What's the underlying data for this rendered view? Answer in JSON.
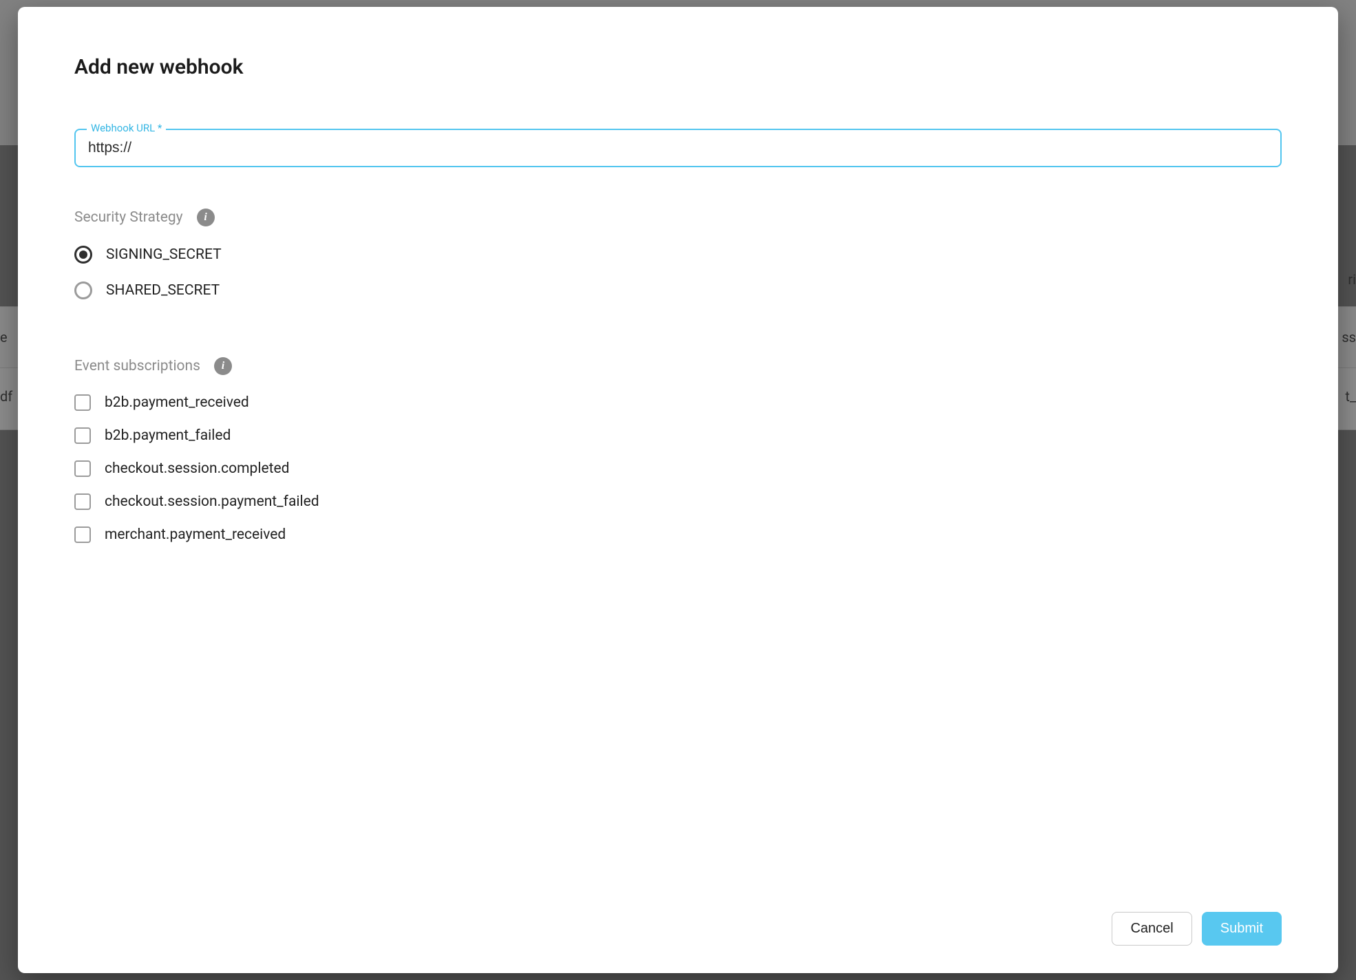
{
  "modal": {
    "title": "Add new webhook",
    "url_field": {
      "label": "Webhook URL *",
      "value": "https://"
    },
    "security": {
      "label": "Security Strategy",
      "options": [
        {
          "value": "SIGNING_SECRET",
          "selected": true
        },
        {
          "value": "SHARED_SECRET",
          "selected": false
        }
      ]
    },
    "events": {
      "label": "Event subscriptions",
      "items": [
        {
          "name": "b2b.payment_received",
          "checked": false
        },
        {
          "name": "b2b.payment_failed",
          "checked": false
        },
        {
          "name": "checkout.session.completed",
          "checked": false
        },
        {
          "name": "checkout.session.payment_failed",
          "checked": false
        },
        {
          "name": "merchant.payment_received",
          "checked": false
        }
      ]
    },
    "footer": {
      "cancel": "Cancel",
      "submit": "Submit"
    }
  },
  "background": {
    "fragments": [
      "ri",
      "ss",
      "e",
      "df",
      "t_"
    ],
    "info_glyph": "i"
  }
}
